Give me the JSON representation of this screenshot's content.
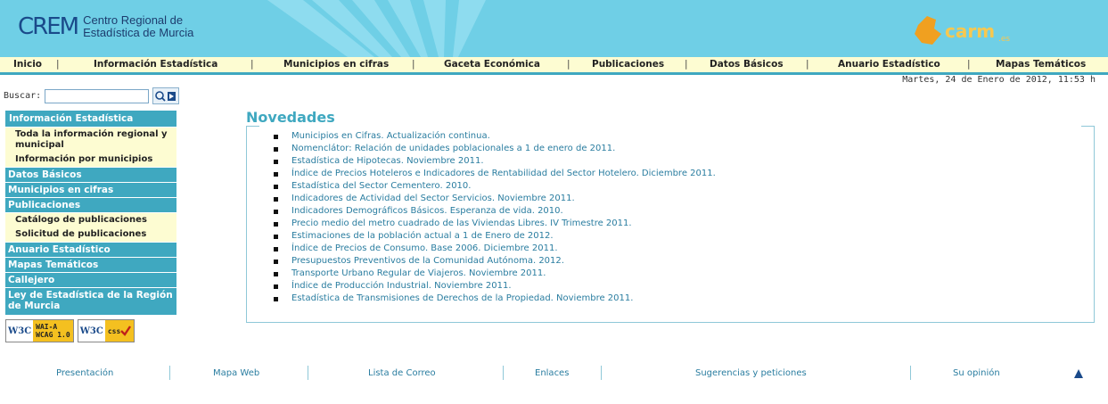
{
  "header": {
    "logo_mark": "CREM",
    "logo_line1": "Centro Regional de",
    "logo_line2": "Estadística de Murcia",
    "carm_logo": "carm.es"
  },
  "nav": {
    "items": [
      "Inicio",
      "Información Estadística",
      "Municipios en cifras",
      "Gaceta Económica",
      "Publicaciones",
      "Datos Básicos",
      "Anuario Estadístico",
      "Mapas Temáticos"
    ],
    "separator": "|"
  },
  "date_text": "Martes, 24 de Enero de 2012, 11:53 h",
  "search": {
    "label": "Buscar:",
    "value": "",
    "button_icon": "search-icon"
  },
  "sidebar": {
    "info_estadistica": "Información Estadística",
    "toda_info": "Toda la información regional y municipal",
    "info_municipios": "Información por municipios",
    "datos_basicos": "Datos Básicos",
    "municipios_cifras": "Municipios en cifras",
    "publicaciones": "Publicaciones",
    "catalogo": "Catálogo de publicaciones",
    "solicitud": "Solicitud de publicaciones",
    "anuario": "Anuario Estadístico",
    "mapas": "Mapas Temáticos",
    "callejero": "Callejero",
    "ley": "Ley de Estadística de la Región de Murcia"
  },
  "badges": {
    "wai_w3c": "W3C",
    "wai_l1": "WAI-A",
    "wai_l2": "WCAG 1.0",
    "css_w3c": "W3C",
    "css_label": "css"
  },
  "main": {
    "title": "Novedades",
    "news": [
      "Municipios en Cifras. Actualización continua.",
      "Nomenclátor: Relación de unidades poblacionales a 1 de enero de 2011.",
      "Estadística de Hipotecas. Noviembre 2011.",
      "Índice de Precios Hoteleros e Indicadores de Rentabilidad del Sector Hotelero. Diciembre 2011.",
      "Estadística del Sector Cementero. 2010.",
      "Indicadores de Actividad del Sector Servicios. Noviembre 2011.",
      "Indicadores Demográficos Básicos. Esperanza de vida. 2010.",
      "Precio medio del metro cuadrado de las Viviendas Libres. IV Trimestre 2011.",
      "Estimaciones de la población actual a 1 de Enero de 2012.",
      "Índice de Precios de Consumo. Base 2006. Diciembre 2011.",
      "Presupuestos Preventivos de la Comunidad Autónoma. 2012.",
      "Transporte Urbano Regular de Viajeros. Noviembre 2011.",
      "Índice de Producción Industrial. Noviembre 2011.",
      "Estadística de Transmisiones de Derechos de la Propiedad. Noviembre 2011."
    ]
  },
  "footer": {
    "items": [
      "Presentación",
      "Mapa Web",
      "Lista de Correo",
      "Enlaces",
      "Sugerencias y peticiones",
      "Su opinión"
    ],
    "up_icon": "arrow-up-icon"
  },
  "colors": {
    "header_bg": "#6fcfe6",
    "accent": "#3fa8c0",
    "nav_bg": "#fdfcd2",
    "link": "#2a7da0"
  }
}
